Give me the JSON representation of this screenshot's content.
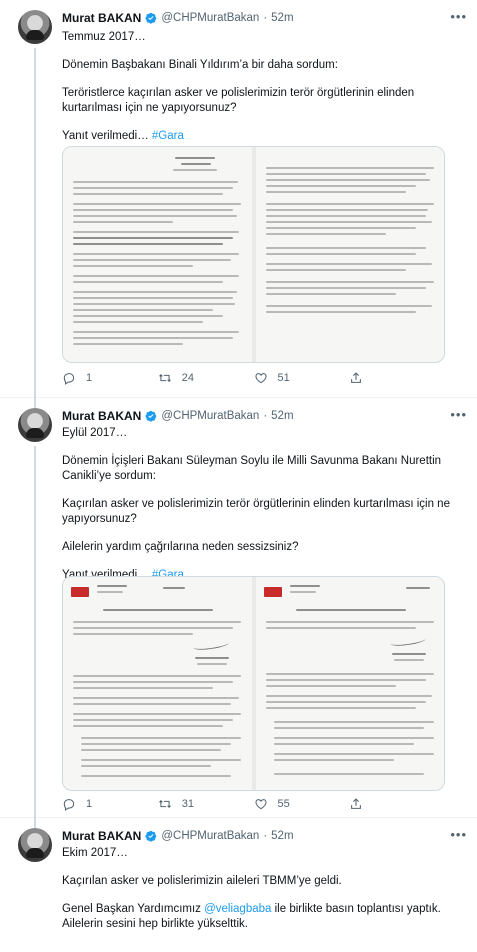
{
  "tweets": [
    {
      "author": {
        "name": "Murat BAKAN",
        "handle": "@CHPMuratBakan",
        "time": "52m"
      },
      "lines": {
        "p1": "Temmuz 2017…",
        "p2": "Dönemin Başbakanı Binali Yıldırım’a bir daha sordum:",
        "p3": "Teröristlerce kaçırılan asker ve polislerimizin terör örgütlerinin elinden kurtarılması için ne yapıyorsunuz?",
        "p4_text": "Yanıt verilmedi… ",
        "p4_hashtag": "#Gara"
      },
      "stats": {
        "replies": "1",
        "retweets": "24",
        "likes": "51"
      }
    },
    {
      "author": {
        "name": "Murat BAKAN",
        "handle": "@CHPMuratBakan",
        "time": "52m"
      },
      "lines": {
        "p1": "Eylül 2017…",
        "p2": "Dönemin İçişleri Bakanı Süleyman Soylu ile Milli Savunma Bakanı Nurettin Canikli’ye sordum:",
        "p3": "Kaçırılan asker ve polislerimizin terör örgütlerinin elinden kurtarılması için ne yapıyorsunuz?",
        "p4": "Ailelerin yardım çağrılarına neden sessizsiniz?",
        "p5_text": "Yanıt verilmedi… ",
        "p5_hashtag": "#Gara"
      },
      "stats": {
        "replies": "1",
        "retweets": "31",
        "likes": "55"
      }
    },
    {
      "author": {
        "name": "Murat BAKAN",
        "handle": "@CHPMuratBakan",
        "time": "52m"
      },
      "lines": {
        "p1": "Ekim 2017…",
        "p2": "Kaçırılan asker ve polislerimizin aileleri TBMM’ye geldi.",
        "p3_pre": "Genel Başkan Yardımcımız ",
        "p3_mention": "@veliagbaba",
        "p3_post": " ile birlikte basın toplantısı yaptık. Ailelerin sesini hep birlikte yükselttik."
      }
    }
  ],
  "icons": {
    "reply": "reply-icon",
    "retweet": "retweet-icon",
    "like": "like-icon",
    "share": "share-icon",
    "verified": "verified-badge-icon",
    "more": "more-icon"
  },
  "colors": {
    "accent": "#1d9bf0",
    "text": "#0f1419",
    "muted": "#536471",
    "border": "#cfd9de"
  }
}
